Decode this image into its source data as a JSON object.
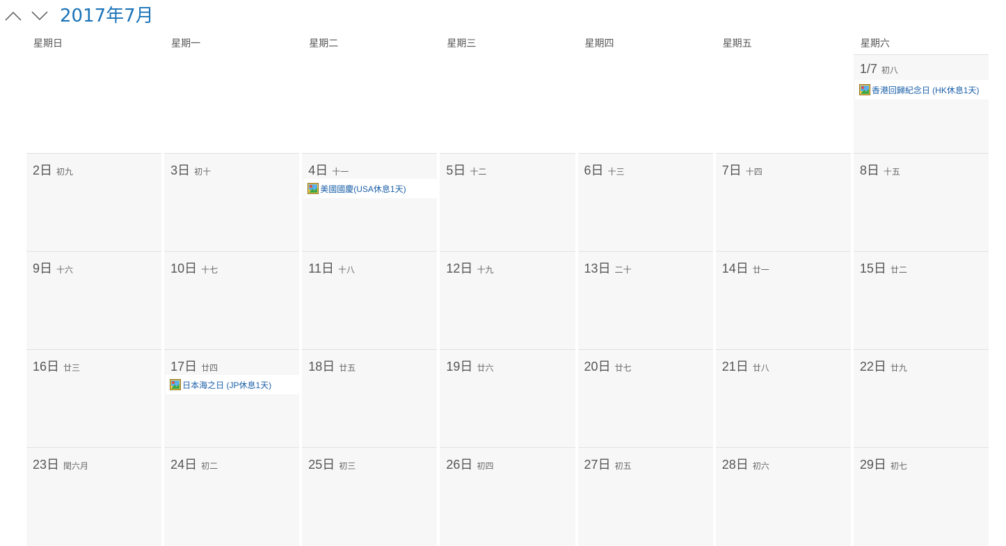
{
  "header": {
    "month_title": "2017年7月",
    "prev_icon": "chevron-up-icon",
    "next_icon": "chevron-down-icon"
  },
  "weekdays": [
    "星期日",
    "星期一",
    "星期二",
    "星期三",
    "星期四",
    "星期五",
    "星期六"
  ],
  "weeks": [
    [
      {
        "empty": true
      },
      {
        "empty": true
      },
      {
        "empty": true
      },
      {
        "empty": true
      },
      {
        "empty": true
      },
      {
        "empty": true
      },
      {
        "day": "1/7",
        "lunar": "初八",
        "events": [
          {
            "icon": "image-icon",
            "label": "香港回歸紀念日 (HK休息1天)"
          }
        ]
      }
    ],
    [
      {
        "day": "2日",
        "lunar": "初九"
      },
      {
        "day": "3日",
        "lunar": "初十"
      },
      {
        "day": "4日",
        "lunar": "十一",
        "events": [
          {
            "icon": "image-icon",
            "label": "美國國慶(USA休息1天)"
          }
        ]
      },
      {
        "day": "5日",
        "lunar": "十二"
      },
      {
        "day": "6日",
        "lunar": "十三"
      },
      {
        "day": "7日",
        "lunar": "十四"
      },
      {
        "day": "8日",
        "lunar": "十五"
      }
    ],
    [
      {
        "day": "9日",
        "lunar": "十六"
      },
      {
        "day": "10日",
        "lunar": "十七"
      },
      {
        "day": "11日",
        "lunar": "十八"
      },
      {
        "day": "12日",
        "lunar": "十九"
      },
      {
        "day": "13日",
        "lunar": "二十"
      },
      {
        "day": "14日",
        "lunar": "廿一"
      },
      {
        "day": "15日",
        "lunar": "廿二"
      }
    ],
    [
      {
        "day": "16日",
        "lunar": "廿三"
      },
      {
        "day": "17日",
        "lunar": "廿四",
        "events": [
          {
            "icon": "image-icon",
            "label": "日本海之日 (JP休息1天)"
          }
        ]
      },
      {
        "day": "18日",
        "lunar": "廿五"
      },
      {
        "day": "19日",
        "lunar": "廿六"
      },
      {
        "day": "20日",
        "lunar": "廿七"
      },
      {
        "day": "21日",
        "lunar": "廿八"
      },
      {
        "day": "22日",
        "lunar": "廿九"
      }
    ],
    [
      {
        "day": "23日",
        "lunar": "閏六月"
      },
      {
        "day": "24日",
        "lunar": "初二"
      },
      {
        "day": "25日",
        "lunar": "初三"
      },
      {
        "day": "26日",
        "lunar": "初四"
      },
      {
        "day": "27日",
        "lunar": "初五"
      },
      {
        "day": "28日",
        "lunar": "初六"
      },
      {
        "day": "29日",
        "lunar": "初七"
      }
    ]
  ],
  "colors": {
    "accent": "#1a73b8",
    "event_text": "#1a5fa8",
    "cell_bg": "#f7f7f7",
    "cell_border": "#e1e1e1"
  }
}
